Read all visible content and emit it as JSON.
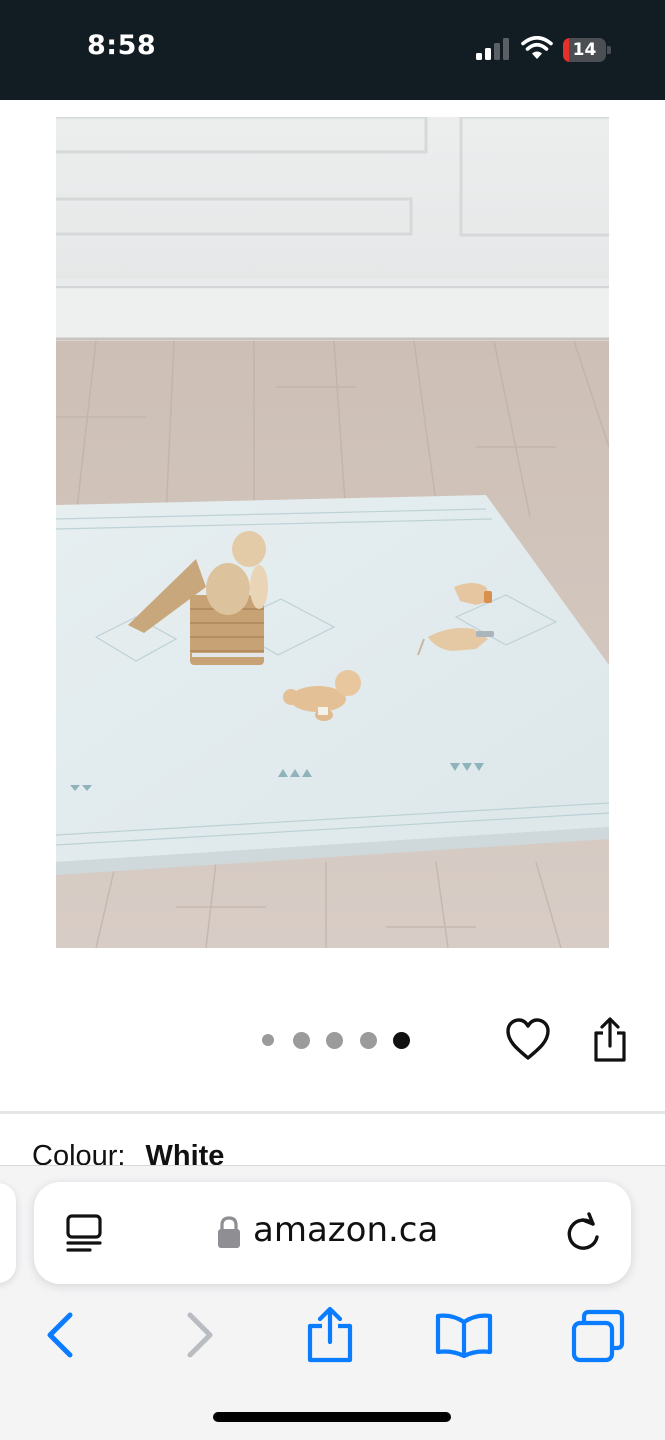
{
  "status_bar": {
    "time": "8:58",
    "battery_level": "14",
    "battery_fraction": 0.14,
    "signal_bars_active": 2,
    "signal_bars_total": 4,
    "icons": [
      "signal-icon",
      "wifi-icon",
      "battery-icon"
    ]
  },
  "gallery": {
    "image_count": 5,
    "active_index": 4,
    "icons": [
      "heart-icon",
      "share-icon"
    ]
  },
  "product": {
    "colour_label": "Colour:",
    "colour_value": "White"
  },
  "browser": {
    "domain": "amazon.ca",
    "icons": [
      "reader-icon",
      "lock-icon",
      "reload-icon",
      "back-icon",
      "forward-icon",
      "share-icon",
      "bookmarks-icon",
      "tabs-icon"
    ],
    "forward_enabled": false
  },
  "colors": {
    "status_bar_bg": "#121c23",
    "accent_blue": "#0a7cff",
    "disabled_gray": "#b9bcc0",
    "battery_low": "#e8302a"
  }
}
